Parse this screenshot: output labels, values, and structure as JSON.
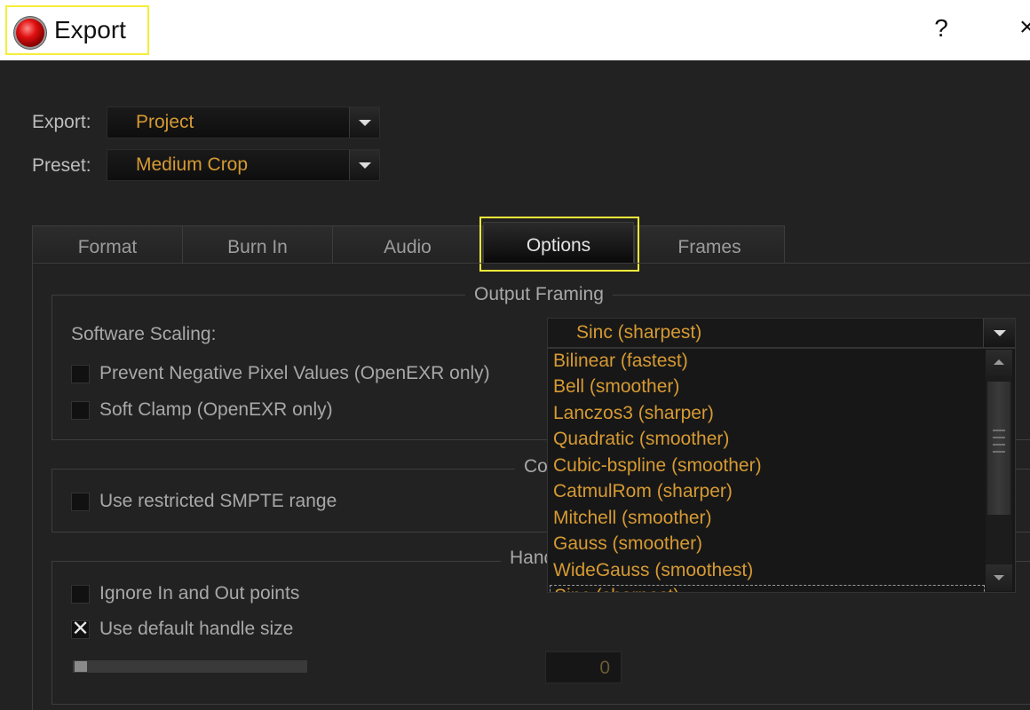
{
  "window": {
    "title": "Export",
    "help_label": "?",
    "close_label": "×"
  },
  "export_row": {
    "label": "Export:",
    "value": "Project"
  },
  "preset_row": {
    "label": "Preset:",
    "value": "Medium Crop"
  },
  "tabs": [
    {
      "label": "Format"
    },
    {
      "label": "Burn In"
    },
    {
      "label": "Audio"
    },
    {
      "label": "Options",
      "active": true
    },
    {
      "label": "Frames"
    }
  ],
  "output_framing": {
    "title": "Output Framing",
    "software_scaling_label": "Software Scaling:",
    "prevent_negative": {
      "label": "Prevent Negative Pixel Values (OpenEXR only)",
      "checked": false
    },
    "soft_clamp": {
      "label": "Soft Clamp (OpenEXR only)",
      "checked": false
    }
  },
  "color_group": {
    "title_visible": "Co",
    "use_restricted": {
      "label": "Use restricted SMPTE range",
      "checked": false
    }
  },
  "handles_group": {
    "title_visible": "Hand",
    "ignore_in_out": {
      "label": "Ignore In and Out points",
      "checked": false
    },
    "use_default_handle": {
      "label": "Use default handle size",
      "checked": true,
      "mark": "✕"
    },
    "handle_value": "0",
    "slider_level": 0
  },
  "scaling_dropdown": {
    "selected": "Sinc (sharpest)",
    "options": [
      "Bilinear (fastest)",
      "Bell (smoother)",
      "Lanczos3 (sharper)",
      "Quadratic (smoother)",
      "Cubic-bspline (smoother)",
      "CatmulRom (sharper)",
      "Mitchell (smoother)",
      "Gauss (smoother)",
      "WideGauss (smoothest)",
      "Sinc (sharpest)"
    ]
  },
  "colors": {
    "accent_text": "#d69a33",
    "highlight": "#f5ee3a",
    "background": "#222222"
  }
}
